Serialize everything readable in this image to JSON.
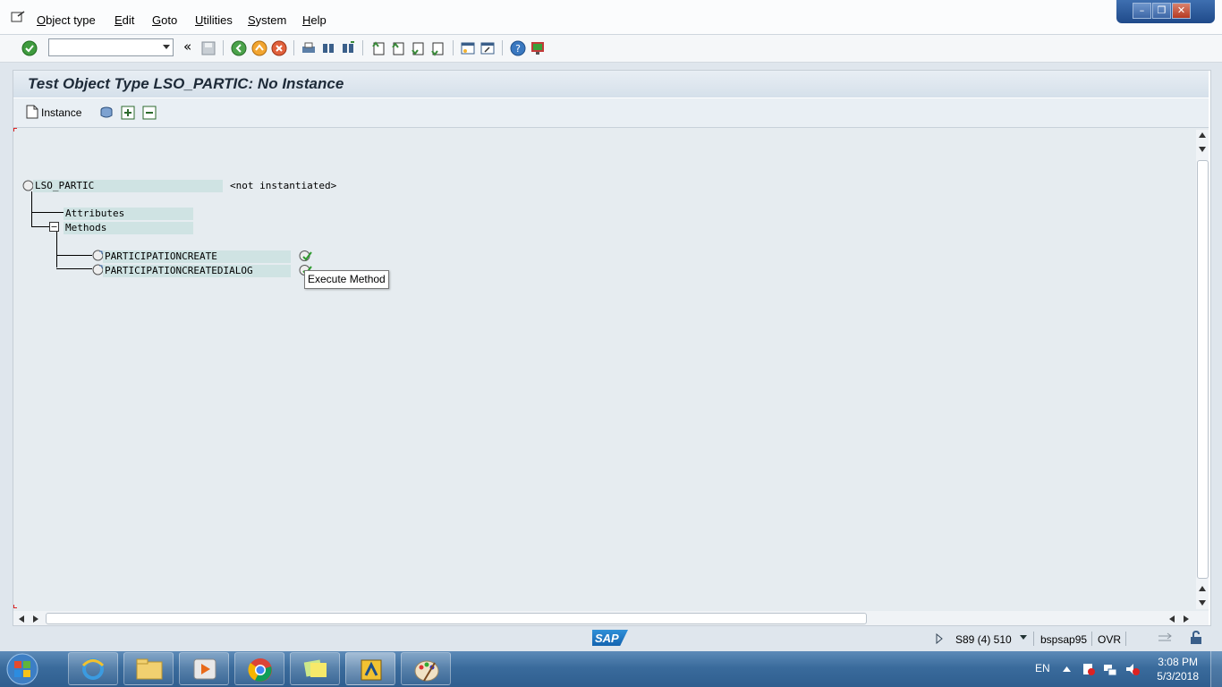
{
  "menu": {
    "items": [
      "Object type",
      "Edit",
      "Goto",
      "Utilities",
      "System",
      "Help"
    ]
  },
  "window_controls": {
    "minimize": "–",
    "restore": "❐",
    "close": "✕"
  },
  "toolbar": {
    "command_field_value": "",
    "back_glyph": "«"
  },
  "page": {
    "title": "Test Object Type LSO_PARTIC: No Instance"
  },
  "app_toolbar": {
    "instance_label": "Instance"
  },
  "tree": {
    "root_label": "LSO_PARTIC",
    "root_status": "<not instantiated>",
    "attributes_label": "Attributes",
    "methods_label": "Methods",
    "methods": [
      "PARTICIPATIONCREATE",
      "PARTICIPATIONCREATEDIALOG"
    ]
  },
  "tooltip": {
    "text": "Execute Method"
  },
  "status_bar": {
    "sap_logo": "SAP",
    "session": "S89 (4) 510",
    "server": "bspsap95",
    "mode": "OVR"
  },
  "taskbar": {
    "language": "EN",
    "time": "3:08 PM",
    "date": "5/3/2018"
  }
}
